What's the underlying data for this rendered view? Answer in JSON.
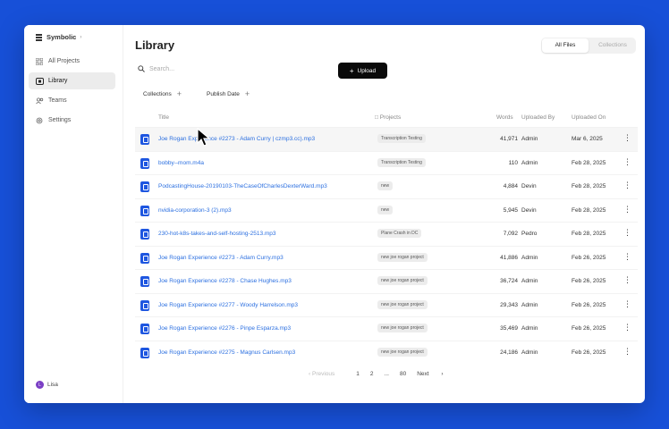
{
  "app": {
    "name": "Symbolic"
  },
  "sidebar": {
    "items": [
      {
        "label": "All Projects",
        "icon": "grid-icon"
      },
      {
        "label": "Library",
        "icon": "library-icon",
        "active": true
      },
      {
        "label": "Teams",
        "icon": "users-icon"
      },
      {
        "label": "Settings",
        "icon": "gear-icon"
      }
    ],
    "user": {
      "initial": "L",
      "name": "Lisa"
    }
  },
  "header": {
    "title": "Library",
    "toggle": {
      "all_files": "All Files",
      "collections": "Collections"
    }
  },
  "search": {
    "placeholder": "Search..."
  },
  "upload_label": "Upload",
  "filters": {
    "collections": "Collections",
    "publish_date": "Publish Date"
  },
  "table": {
    "columns": {
      "title": "Title",
      "projects": "Projects",
      "words": "Words",
      "uploaded_by": "Uploaded By",
      "uploaded_on": "Uploaded On"
    },
    "rows": [
      {
        "title": "Joe Rogan Experience #2273 - Adam Curry | czmp3.cc).mp3",
        "project": "Transcription Testing",
        "words": "41,971",
        "by": "Admin",
        "on": "Mar 6, 2025"
      },
      {
        "title": "bobby--mom.m4a",
        "project": "Transcription Testing",
        "words": "110",
        "by": "Admin",
        "on": "Feb 28, 2025"
      },
      {
        "title": "PodcastingHouse-20190103-TheCaseOfCharlesDexterWard.mp3",
        "project": "new",
        "words": "4,884",
        "by": "Devin",
        "on": "Feb 28, 2025"
      },
      {
        "title": "nvidia-corporation-3 (2).mp3",
        "project": "new",
        "words": "5,945",
        "by": "Devin",
        "on": "Feb 28, 2025"
      },
      {
        "title": "230-hot-k8s-takes-and-self-hosting-2513.mp3",
        "project": "Plane Crash in DC",
        "words": "7,092",
        "by": "Pedro",
        "on": "Feb 28, 2025"
      },
      {
        "title": "Joe Rogan Experience #2273 - Adam Curry.mp3",
        "project": "new joe rogan project",
        "words": "41,886",
        "by": "Admin",
        "on": "Feb 26, 2025"
      },
      {
        "title": "Joe Rogan Experience #2278 - Chase Hughes.mp3",
        "project": "new joe rogan project",
        "words": "36,724",
        "by": "Admin",
        "on": "Feb 26, 2025"
      },
      {
        "title": "Joe Rogan Experience #2277 - Woody Harrelson.mp3",
        "project": "new joe rogan project",
        "words": "29,343",
        "by": "Admin",
        "on": "Feb 26, 2025"
      },
      {
        "title": "Joe Rogan Experience #2276 - Pinpe Esparza.mp3",
        "project": "new joe rogan project",
        "words": "35,469",
        "by": "Admin",
        "on": "Feb 26, 2025"
      },
      {
        "title": "Joe Rogan Experience #2275 - Magnus Carlsen.mp3",
        "project": "new joe rogan project",
        "words": "24,186",
        "by": "Admin",
        "on": "Feb 26, 2025"
      }
    ]
  },
  "pagination": {
    "previous": "Previous",
    "pages": [
      "1",
      "2",
      "...",
      "80"
    ],
    "next": "Next"
  }
}
